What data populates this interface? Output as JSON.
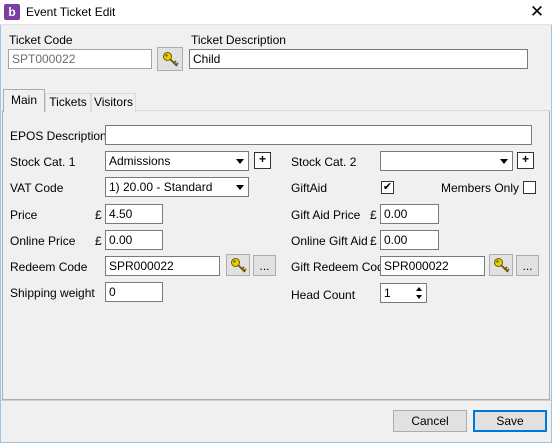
{
  "window": {
    "title": "Event Ticket Edit",
    "app_icon": "b",
    "close_icon": "close-icon"
  },
  "header": {
    "ticket_code_label": "Ticket Code",
    "ticket_code_value": "SPT000022",
    "ticket_description_label": "Ticket Description",
    "ticket_description_value": "Child"
  },
  "tabs": [
    {
      "label": "Main"
    },
    {
      "label": "Tickets"
    },
    {
      "label": "Visitors"
    }
  ],
  "main": {
    "epos_description_label": "EPOS Description",
    "epos_description_value": "",
    "stock_cat1_label": "Stock Cat. 1",
    "stock_cat1_value": "Admissions",
    "stock_cat2_label": "Stock Cat. 2",
    "stock_cat2_value": "",
    "vat_code_label": "VAT Code",
    "vat_code_value": "1) 20.00 - Standard",
    "giftaid_label": "GiftAid",
    "giftaid_checked": true,
    "members_only_label": "Members Only",
    "members_only_checked": false,
    "price_label": "Price",
    "currency_symbol": "£",
    "price_value": "4.50",
    "gift_aid_price_label": "Gift Aid Price",
    "gift_aid_price_value": "0.00",
    "online_price_label": "Online Price",
    "online_price_value": "0.00",
    "online_gift_aid_label": "Online Gift Aid",
    "online_gift_aid_value": "0.00",
    "redeem_code_label": "Redeem Code",
    "redeem_code_value": "SPR000022",
    "gift_redeem_code_label": "Gift Redeem Code",
    "gift_redeem_code_value": "SPR000022",
    "ellipsis_label": "...",
    "shipping_weight_label": "Shipping weight",
    "shipping_weight_value": "0",
    "head_count_label": "Head Count",
    "head_count_value": "1",
    "add_symbol": "+"
  },
  "footer": {
    "cancel_label": "Cancel",
    "save_label": "Save"
  },
  "colors": {
    "accent": "#0078d7",
    "app_icon_bg": "#7a3fa0",
    "key_icon": "#d8c000"
  }
}
